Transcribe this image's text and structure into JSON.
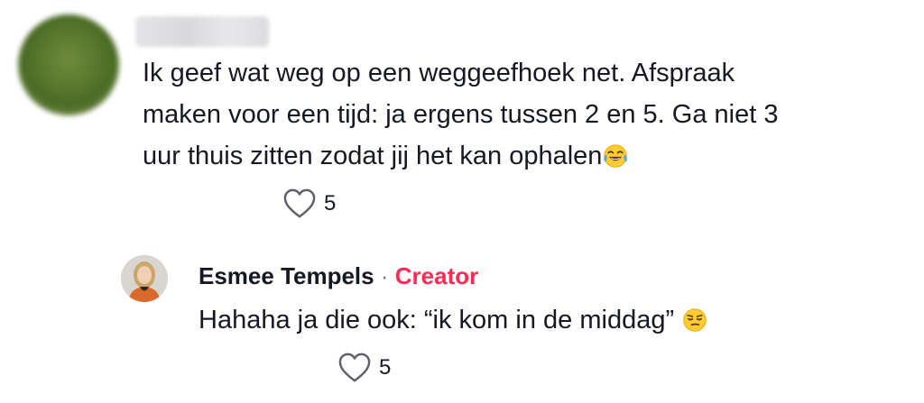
{
  "comment": {
    "text_lines": [
      "Ik geef wat weg op een weggeefhoek net. Afspraak",
      "maken voor een tijd: ja ergens tussen 2 en 5. Ga niet 3",
      "uur thuis zitten zodat jij het kan ophalen"
    ],
    "emoji": "face-with-tears-of-joy-icon",
    "like_count": "5"
  },
  "reply": {
    "author": "Esmee Tempels",
    "separator": "·",
    "badge": "Creator",
    "text": "Hahaha ja die ook: “ik kom in de middag”",
    "emoji": "unamused-face-icon",
    "like_count": "5"
  },
  "colors": {
    "text": "#161823",
    "creator_badge": "#fe2c55",
    "separator": "#7a7b82",
    "heart_outline": "#5f6068"
  }
}
